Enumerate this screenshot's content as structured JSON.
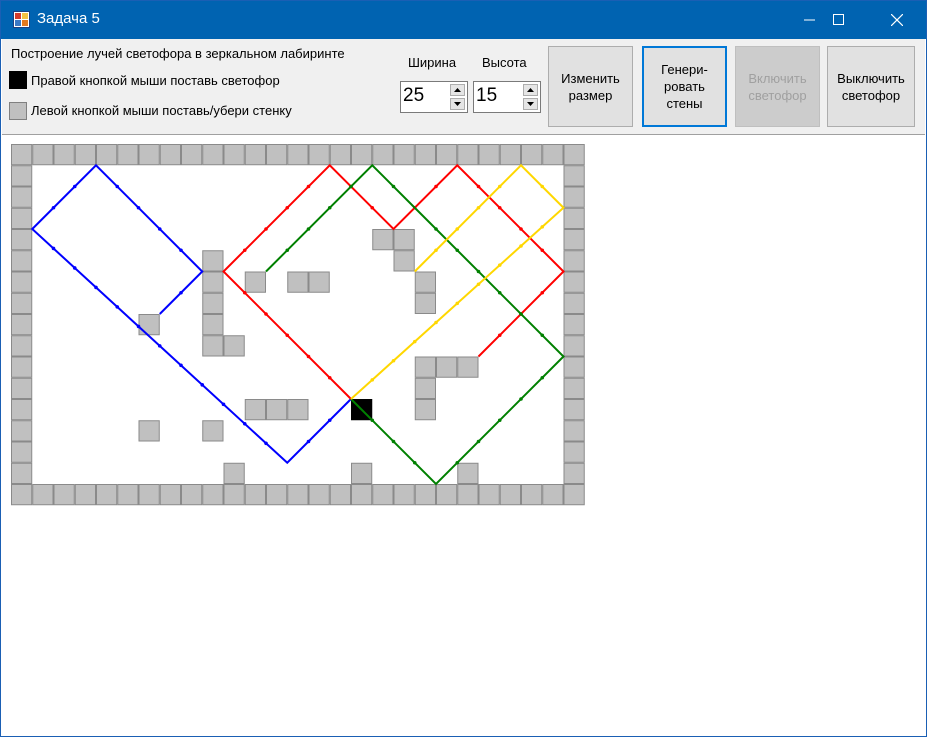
{
  "window": {
    "title": "Задача 5"
  },
  "header": {
    "description": "Построение лучей светофора в зеркальном лабиринте",
    "legend_light": "Правой кнопкой мыши поставь светофор",
    "legend_wall": "Левой кнопкой мыши поставь/убери стенку"
  },
  "size": {
    "width_label": "Ширина",
    "width_value": "25",
    "height_label": "Высота",
    "height_value": "15"
  },
  "buttons": {
    "resize": "Изменить\nразмер",
    "generate": "Генери-\nровать\nстены",
    "enable": "Включить\nсветофор",
    "disable": "Выключить\nсветофор"
  },
  "maze": {
    "cols": 27,
    "rows": 17,
    "wall_color": "#c0c0c0",
    "light_color": "#000000",
    "inner_walls": [
      [
        9,
        5
      ],
      [
        9,
        6
      ],
      [
        11,
        6
      ],
      [
        13,
        6
      ],
      [
        14,
        6
      ],
      [
        9,
        7
      ],
      [
        6,
        8
      ],
      [
        9,
        8
      ],
      [
        9,
        9
      ],
      [
        10,
        9
      ],
      [
        18,
        4
      ],
      [
        17,
        4
      ],
      [
        18,
        5
      ],
      [
        19,
        6
      ],
      [
        19,
        7
      ],
      [
        19,
        10
      ],
      [
        20,
        10
      ],
      [
        21,
        10
      ],
      [
        19,
        11
      ],
      [
        19,
        12
      ],
      [
        11,
        12
      ],
      [
        12,
        12
      ],
      [
        13,
        12
      ],
      [
        6,
        13
      ],
      [
        9,
        13
      ],
      [
        10,
        15
      ],
      [
        16,
        15
      ],
      [
        21,
        15
      ]
    ],
    "traffic_light": [
      16,
      12
    ],
    "rays": [
      {
        "color": "#0000ff",
        "points": [
          [
            16,
            12
          ],
          [
            13,
            15
          ],
          [
            1,
            4
          ],
          [
            4,
            1
          ],
          [
            9,
            6
          ],
          [
            7,
            8
          ]
        ]
      },
      {
        "color": "#ff0000",
        "points": [
          [
            16,
            12
          ],
          [
            10,
            6
          ],
          [
            15,
            1
          ],
          [
            18,
            4
          ],
          [
            21,
            1
          ],
          [
            26,
            6
          ],
          [
            22,
            10
          ]
        ]
      },
      {
        "color": "#008000",
        "points": [
          [
            16,
            12
          ],
          [
            20,
            16
          ],
          [
            26,
            10
          ],
          [
            19,
            3
          ],
          [
            17,
            1
          ],
          [
            12,
            6
          ]
        ]
      },
      {
        "color": "#ffd700",
        "points": [
          [
            16,
            12
          ],
          [
            26,
            3
          ],
          [
            24,
            1
          ],
          [
            19,
            6
          ]
        ]
      }
    ]
  }
}
